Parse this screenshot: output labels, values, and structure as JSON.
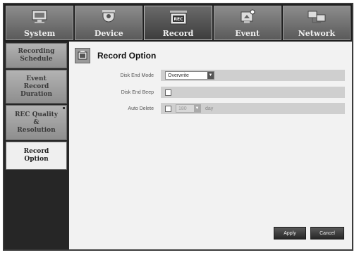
{
  "tabs": [
    {
      "label": "System",
      "icon": "monitor-icon",
      "active": false
    },
    {
      "label": "Device",
      "icon": "camera-icon",
      "active": false
    },
    {
      "label": "Record",
      "icon": "recorder-icon",
      "active": true
    },
    {
      "label": "Event",
      "icon": "alert-icon",
      "active": false
    },
    {
      "label": "Network",
      "icon": "network-icon",
      "active": false
    }
  ],
  "sidebar": {
    "items": [
      {
        "label": "Recording\nSchedule",
        "active": false
      },
      {
        "label": "Event\nRecord\nDuration",
        "active": false
      },
      {
        "label": "REC Quality\n&\nResolution",
        "active": false
      },
      {
        "label": "Record\nOption",
        "active": true
      }
    ]
  },
  "panel": {
    "title": "Record Option",
    "icon": "record-option-icon"
  },
  "fields": {
    "disk_end_mode": {
      "label": "Disk End Mode",
      "value": "Overwrite"
    },
    "disk_end_beep": {
      "label": "Disk End Beep",
      "checked": false
    },
    "auto_delete": {
      "label": "Auto Delete",
      "checked": false,
      "value": "180",
      "unit": "day"
    }
  },
  "buttons": {
    "apply": "Apply",
    "cancel": "Cancel"
  },
  "colors": {
    "accent": "#3d3d3d",
    "panel_bg": "#f2f2f2",
    "field_bg": "#cfcfcf"
  }
}
